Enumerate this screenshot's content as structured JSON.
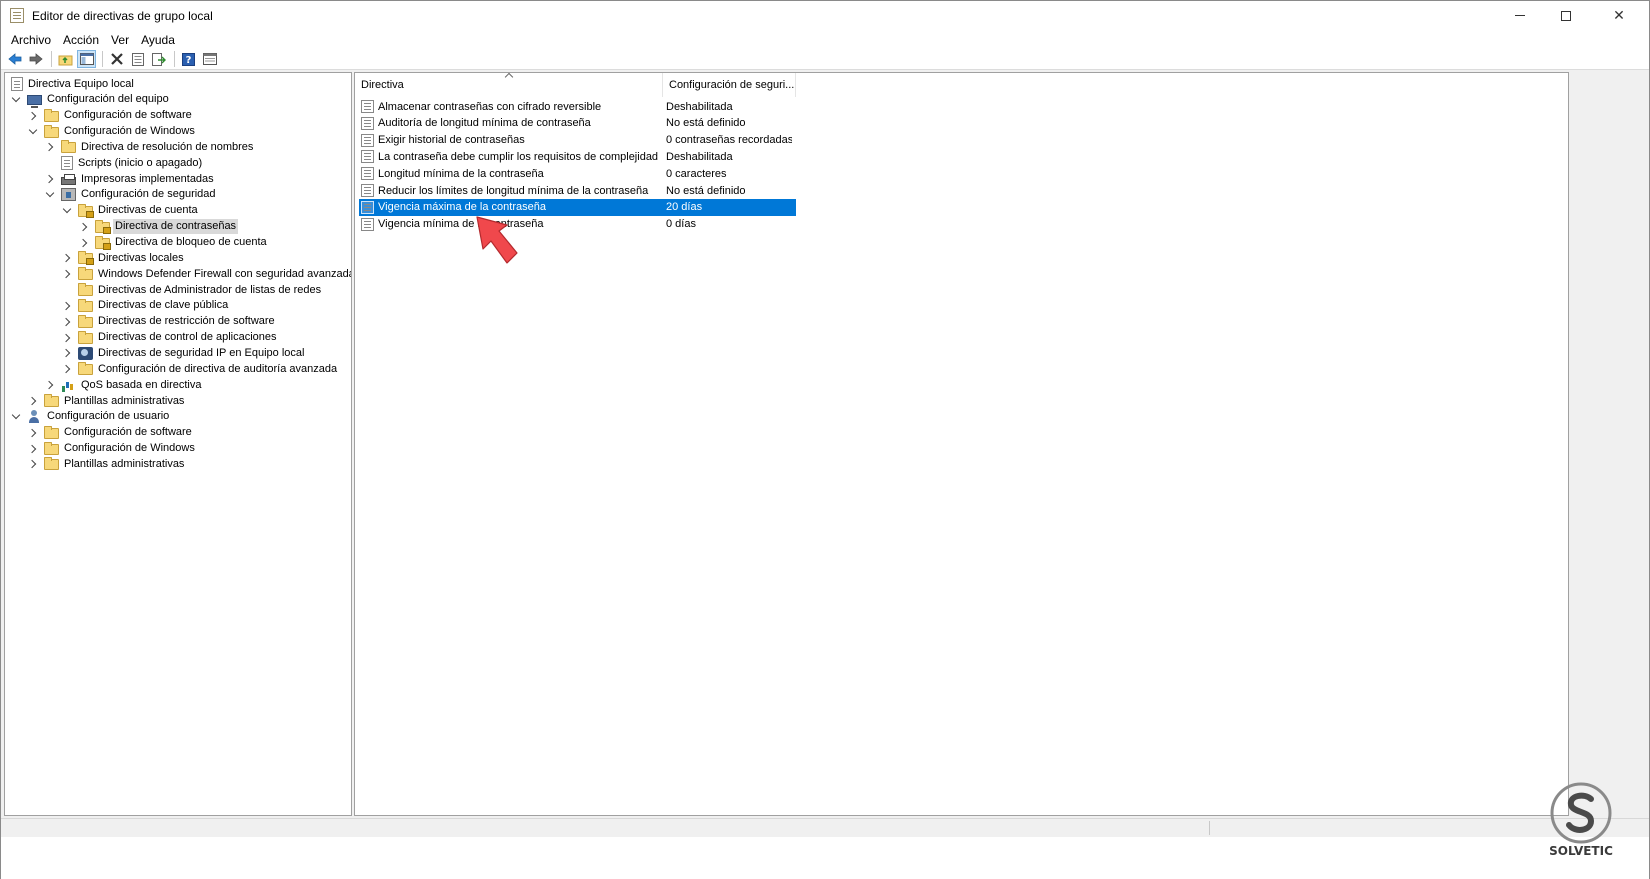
{
  "window": {
    "title": "Editor de directivas de grupo local",
    "controls": {
      "minimize": "minimize-icon",
      "maximize": "maximize-icon",
      "close": "✕"
    }
  },
  "menu": [
    {
      "label": "Archivo"
    },
    {
      "label": "Acción"
    },
    {
      "label": "Ver"
    },
    {
      "label": "Ayuda"
    }
  ],
  "toolbar": {
    "buttons": [
      "back-arrow-icon",
      "forward-arrow-icon",
      "up-folder-icon",
      "show-hide-tree-icon",
      "delete-icon",
      "properties-icon",
      "export-list-icon",
      "help-icon",
      "view-icon"
    ]
  },
  "tree": [
    {
      "label": "Directiva Equipo local",
      "level": 0,
      "expander": "none",
      "icon": "doc"
    },
    {
      "label": "Configuración del equipo",
      "level": 0,
      "expander": "down",
      "icon": "pc"
    },
    {
      "label": "Configuración de software",
      "level": 1,
      "expander": "right",
      "icon": "folder"
    },
    {
      "label": "Configuración de Windows",
      "level": 1,
      "expander": "down",
      "icon": "folder"
    },
    {
      "label": "Directiva de resolución de nombres",
      "level": 2,
      "expander": "right",
      "icon": "folder"
    },
    {
      "label": "Scripts (inicio o apagado)",
      "level": 2,
      "expander": "none",
      "icon": "doc"
    },
    {
      "label": "Impresoras implementadas",
      "level": 2,
      "expander": "right",
      "icon": "printer"
    },
    {
      "label": "Configuración de seguridad",
      "level": 2,
      "expander": "down",
      "icon": "shield"
    },
    {
      "label": "Directivas de cuenta",
      "level": 3,
      "expander": "down",
      "icon": "folder-lock"
    },
    {
      "label": "Directiva de contraseñas",
      "level": 4,
      "expander": "right",
      "icon": "folder-lock",
      "selected": true
    },
    {
      "label": "Directiva de bloqueo de cuenta",
      "level": 4,
      "expander": "right",
      "icon": "folder-lock"
    },
    {
      "label": "Directivas locales",
      "level": 3,
      "expander": "right",
      "icon": "folder-lock"
    },
    {
      "label": "Windows Defender Firewall con seguridad avanzada",
      "level": 3,
      "expander": "right",
      "icon": "folder"
    },
    {
      "label": "Directivas de Administrador de listas de redes",
      "level": 3,
      "expander": "none",
      "icon": "folder"
    },
    {
      "label": "Directivas de clave pública",
      "level": 3,
      "expander": "right",
      "icon": "folder"
    },
    {
      "label": "Directivas de restricción de software",
      "level": 3,
      "expander": "right",
      "icon": "folder"
    },
    {
      "label": "Directivas de control de aplicaciones",
      "level": 3,
      "expander": "right",
      "icon": "folder"
    },
    {
      "label": "Directivas de seguridad IP en Equipo local",
      "level": 3,
      "expander": "right",
      "icon": "ipsec"
    },
    {
      "label": "Configuración de directiva de auditoría avanzada",
      "level": 3,
      "expander": "right",
      "icon": "folder"
    },
    {
      "label": "QoS basada en directiva",
      "level": 2,
      "expander": "right",
      "icon": "chart"
    },
    {
      "label": "Plantillas administrativas",
      "level": 1,
      "expander": "right",
      "icon": "folder"
    },
    {
      "label": "Configuración de usuario",
      "level": 0,
      "expander": "down",
      "icon": "user"
    },
    {
      "label": "Configuración de software",
      "level": 1,
      "expander": "right",
      "icon": "folder"
    },
    {
      "label": "Configuración de Windows",
      "level": 1,
      "expander": "right",
      "icon": "folder"
    },
    {
      "label": "Plantillas administrativas",
      "level": 1,
      "expander": "right",
      "icon": "folder"
    }
  ],
  "list": {
    "columns": [
      "Directiva",
      "Configuración de seguri..."
    ],
    "rows": [
      {
        "policy": "Almacenar contraseñas con cifrado reversible",
        "setting": "Deshabilitada"
      },
      {
        "policy": "Auditoría de longitud mínima de contraseña",
        "setting": "No está definido"
      },
      {
        "policy": "Exigir historial de contraseñas",
        "setting": "0 contraseñas recordadas"
      },
      {
        "policy": "La contraseña debe cumplir los requisitos de complejidad",
        "setting": "Deshabilitada"
      },
      {
        "policy": "Longitud mínima de la contraseña",
        "setting": "0 caracteres"
      },
      {
        "policy": "Reducir los límites de longitud mínima de la contraseña",
        "setting": "No está definido"
      },
      {
        "policy": "Vigencia máxima de la contraseña",
        "setting": "20 días",
        "selected": true
      },
      {
        "policy": "Vigencia mínima de la contraseña",
        "setting": "0 días"
      }
    ]
  },
  "colors": {
    "selection": "#0078d7",
    "annotation_arrow": "#f0484c",
    "tree_selection": "#d9d9d9"
  },
  "logo": {
    "text": "SOLVETIC"
  }
}
